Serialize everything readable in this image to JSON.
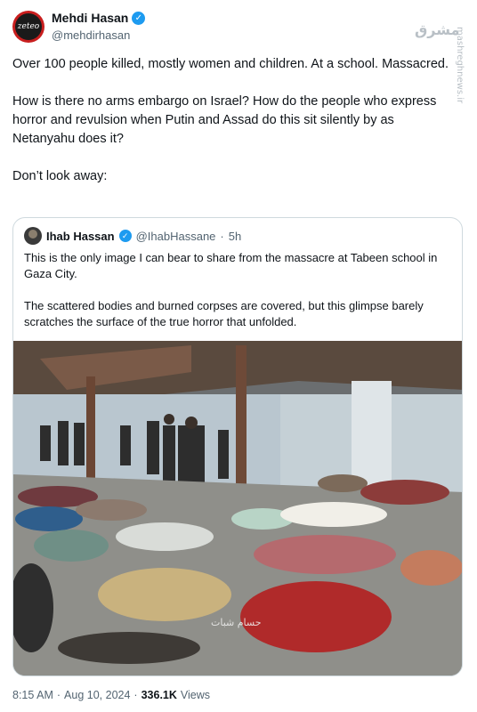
{
  "author": {
    "display_name": "Mehdi Hasan",
    "handle": "@mehdirhasan",
    "avatar_text": "zeteo"
  },
  "watermark": {
    "logo": "مشرق",
    "site": "mashreghnews.ir"
  },
  "tweet": {
    "paragraphs": [
      "Over 100 people killed, mostly women and children. At a school. Massacred.",
      "How is there no arms embargo on Israel? How do the people who express horror and revulsion when Putin and Assad do this sit silently by as Netanyahu does it?",
      "Don’t look away:"
    ]
  },
  "quote": {
    "display_name": "Ihab Hassan",
    "handle": "@IhabHassane",
    "separator": "·",
    "time": "5h",
    "paragraphs": [
      "This is the only image I can bear to share from the massacre at Tabeen school in Gaza City.",
      "The scattered bodies and burned corpses are covered, but this glimpse barely scratches the surface of the true horror that unfolded."
    ],
    "photo_credit": "حسام شبات"
  },
  "meta": {
    "time": "8:15 AM",
    "separator": "·",
    "date": "Aug 10, 2024",
    "views_count": "336.1K",
    "views_label": "Views"
  },
  "colors": {
    "verified": "#1d9bf0",
    "secondary_text": "#536471",
    "border": "#cfd9de"
  }
}
